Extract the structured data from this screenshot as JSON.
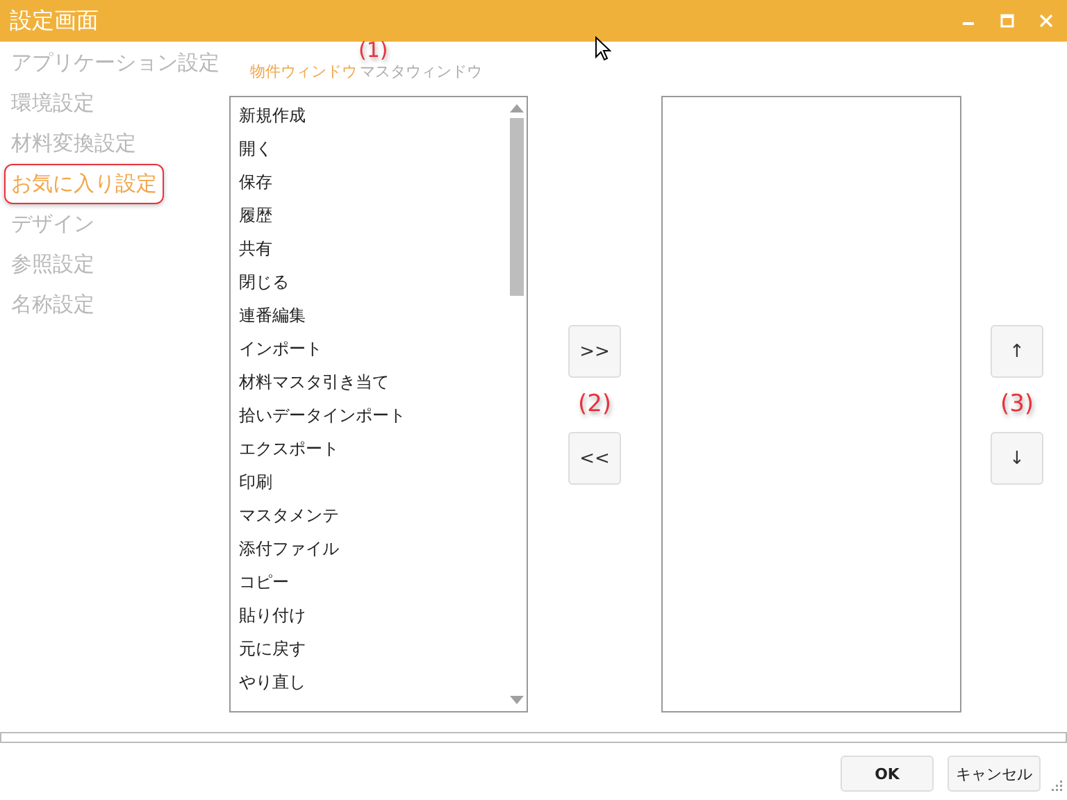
{
  "window": {
    "title": "設定画面"
  },
  "sidebar": {
    "items": [
      {
        "label": "アプリケーション設定",
        "selected": false
      },
      {
        "label": "環境設定",
        "selected": false
      },
      {
        "label": "材料変換設定",
        "selected": false
      },
      {
        "label": "お気に入り設定",
        "selected": true
      },
      {
        "label": "デザイン",
        "selected": false
      },
      {
        "label": "参照設定",
        "selected": false
      },
      {
        "label": "名称設定",
        "selected": false
      }
    ]
  },
  "tabs": [
    {
      "label": "物件ウィンドウ",
      "selected": true
    },
    {
      "label": "マスタウィンドウ",
      "selected": false
    }
  ],
  "available_list": {
    "items": [
      "新規作成",
      "開く",
      "保存",
      "履歴",
      "共有",
      "閉じる",
      "連番編集",
      "インポート",
      "材料マスタ引き当て",
      "拾いデータインポート",
      "エクスポート",
      "印刷",
      "マスタメンテ",
      "添付ファイル",
      "コピー",
      "貼り付け",
      "元に戻す",
      "やり直し"
    ]
  },
  "transfer_buttons": [
    ">>",
    "<<"
  ],
  "order_buttons": [
    "↑",
    "↓"
  ],
  "annotations": [
    "(1)",
    "(2)",
    "(3)"
  ],
  "footer": {
    "buttons": [
      "OK",
      "キャンセル"
    ]
  }
}
